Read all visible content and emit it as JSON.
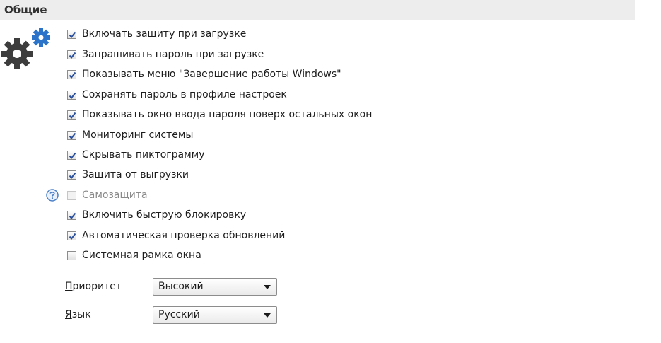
{
  "section": {
    "title": "Общие"
  },
  "options": [
    {
      "label": "Включать защиту при загрузке",
      "checked": true,
      "disabled": false
    },
    {
      "label": "Запрашивать пароль при загрузке",
      "checked": true,
      "disabled": false
    },
    {
      "label": "Показывать меню \"Завершение работы Windows\"",
      "checked": true,
      "disabled": false
    },
    {
      "label": "Сохранять пароль в профиле настроек",
      "checked": true,
      "disabled": false
    },
    {
      "label": "Показывать окно ввода пароля поверх остальных окон",
      "checked": true,
      "disabled": false
    },
    {
      "label": "Мониторинг системы",
      "checked": true,
      "disabled": false
    },
    {
      "label": "Скрывать пиктограмму",
      "checked": true,
      "disabled": false
    },
    {
      "label": "Защита от выгрузки",
      "checked": true,
      "disabled": false
    },
    {
      "label": "Самозащита",
      "checked": false,
      "disabled": true
    },
    {
      "label": "Включить быструю блокировку",
      "checked": true,
      "disabled": false
    },
    {
      "label": "Автоматическая проверка обновлений",
      "checked": true,
      "disabled": false
    },
    {
      "label": "Системная рамка окна",
      "checked": false,
      "disabled": false
    }
  ],
  "priority": {
    "label_access": "П",
    "label_rest": "риоритет",
    "value": "Высокий"
  },
  "language": {
    "label_access": "Я",
    "label_rest": "зык",
    "value": "Русский"
  },
  "colors": {
    "check": "#2a4f9a",
    "gear_dark": "#3d3d3d",
    "gear_blue": "#2b74c9",
    "help": "#4a7fc8"
  },
  "icons": {
    "settings": "gears-icon",
    "help": "help-icon",
    "dropdown": "chevron-down-icon"
  }
}
